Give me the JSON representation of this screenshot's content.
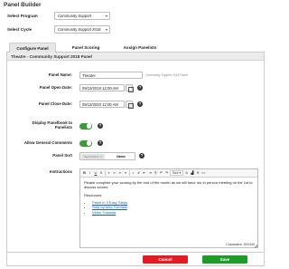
{
  "page": {
    "title": "Panel Builder"
  },
  "filters": {
    "program": {
      "label": "Select Program",
      "value": "Community Support"
    },
    "cycle": {
      "label": "Select Cycle",
      "value": "Community Support 2018"
    }
  },
  "tabs": [
    {
      "label": "Configure Panel",
      "active": true
    },
    {
      "label": "Panel Scoring",
      "active": false
    },
    {
      "label": "Assign Panelists",
      "active": false
    }
  ],
  "panel": {
    "header": "Theatre - Community Support 2018 Panel",
    "name": {
      "label": "Panel Name:",
      "value": "Theatre",
      "hint": "Community Support 2018 Panel"
    },
    "open_date": {
      "label": "Panel Open Date:",
      "value": "09/13/2019 12:00 AM"
    },
    "close_date": {
      "label": "Panel Close Date:",
      "value": "09/13/2020 12:00 AM"
    },
    "display_panelbook": {
      "label_line1": "Display Panelbook to",
      "label_line2": "Panelists",
      "on": true
    },
    "allow_comments": {
      "label": "Allow General Comments",
      "on": true
    },
    "sort": {
      "label": "Panel Sort",
      "option_a": "Application #",
      "option_b": "Name"
    },
    "instructions": {
      "label": "Instructions",
      "paragraph": "Please complete your scoring by the end of the month as we will have our in person meeting on the 1st to discuss scores.",
      "resources_heading": "Resources:",
      "links": [
        "Panel in 3 Easy Steps",
        "Step-by-step Tutorials",
        "Video Tutorials"
      ],
      "char_count": "Characters: 192/400",
      "size_label": "Size"
    }
  },
  "actions": {
    "cancel": "Cancel",
    "save": "Save"
  },
  "colors": {
    "toggle_on": "#3c9a3c",
    "cancel": "#e31c23",
    "save": "#1d9c2a",
    "link": "#1a5fb4"
  }
}
